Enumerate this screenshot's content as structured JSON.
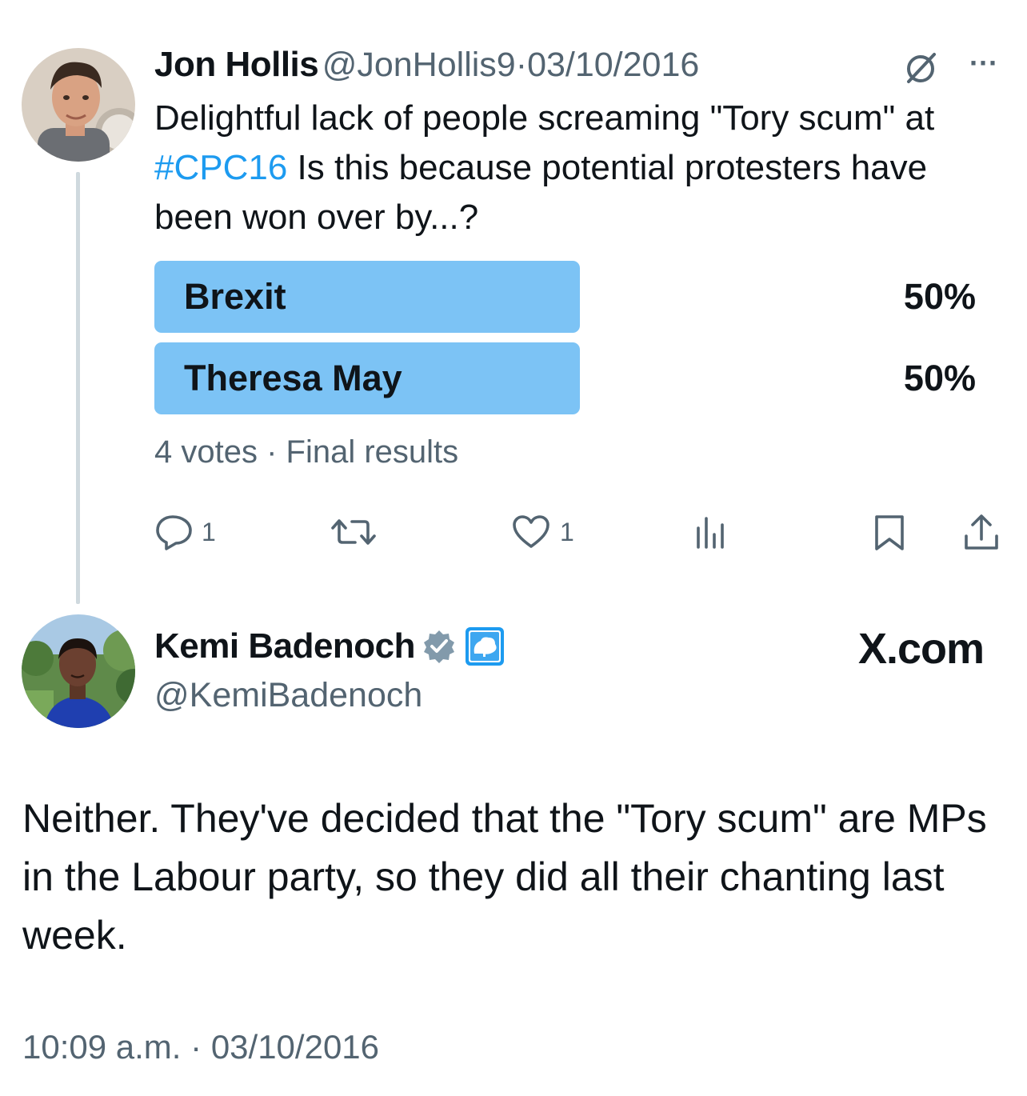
{
  "original_tweet": {
    "author_name": "Jon Hollis",
    "handle": "@JonHollis9",
    "separator": "·",
    "date": "03/10/2016",
    "more_label": "···",
    "text_before_hashtag": "Delightful lack of people screaming \"Tory scum\" at ",
    "hashtag": "#CPC16",
    "text_after_hashtag": " Is this because potential protesters have been won over by...?",
    "poll": {
      "options": [
        {
          "label": "Brexit",
          "percent_text": "50%",
          "share": 0.5
        },
        {
          "label": "Theresa May",
          "percent_text": "50%",
          "share": 0.5
        }
      ],
      "votes": "4 votes",
      "separator": "·",
      "status": "Final results"
    },
    "actions": {
      "reply_count": "1",
      "retweet_count": "",
      "like_count": "1"
    }
  },
  "reply_tweet": {
    "author_name": "Kemi Badenoch",
    "handle": "@KemiBadenoch",
    "site_label": "X.com",
    "text": "Neither.  They've decided that the \"Tory scum\" are MPs in the Labour party, so they did all their chanting last week.",
    "time": "10:09 a.m.",
    "separator": "·",
    "date": "03/10/2016"
  },
  "colors": {
    "link": "#1d9bf0",
    "poll_bar": "#7cc3f5",
    "secondary_text": "#536471",
    "verified_badge": "#829aab",
    "affiliate_badge": "#1d9bf0"
  }
}
